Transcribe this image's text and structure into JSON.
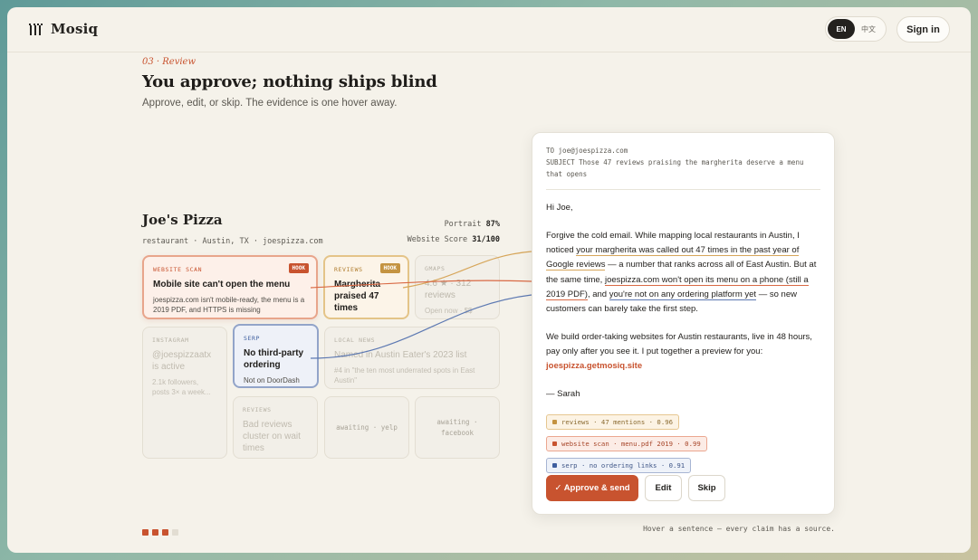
{
  "brand": {
    "name": "Mosiq"
  },
  "header": {
    "lang_en": "EN",
    "lang_zh": "中文",
    "signin_label": "Sign in"
  },
  "hero": {
    "eyebrow": "03 · Review",
    "title": "You approve; nothing ships blind",
    "subtitle": "Approve, edit, or skip. The evidence is one hover away."
  },
  "business": {
    "name": "Joe's Pizza",
    "meta": "restaurant · Austin, TX · joespizza.com",
    "portrait_label": "Portrait",
    "portrait_value": "87%",
    "score_label": "Website Score",
    "score_value": "31/100"
  },
  "cards": {
    "website_scan": {
      "tag": "WEBSITE SCAN",
      "hook": "HOOK",
      "title": "Mobile site can't open the menu",
      "body": "joespizza.com isn't mobile-ready, the menu is a 2019 PDF, and HTTPS is missing"
    },
    "reviews": {
      "tag": "REVIEWS",
      "hook": "HOOK",
      "title": "Margherita praised 47 times"
    },
    "gmaps": {
      "tag": "GMAPS",
      "title": "4.6 ★ · 312 reviews",
      "body": "Open now · $$"
    },
    "instagram": {
      "tag": "INSTAGRAM",
      "title": "@joespizzaatx is active",
      "body": "2.1k followers, posts 3× a week..."
    },
    "serp": {
      "tag": "SERP",
      "title": "No third-party ordering",
      "body": "Not on DoorDash"
    },
    "local_news": {
      "tag": "LOCAL NEWS",
      "title": "Named in Austin Eater's 2023 list",
      "body": "#4 in \"the ten most underrated spots in East Austin\""
    },
    "reviews2": {
      "tag": "REVIEWS",
      "title": "Bad reviews cluster on wait times"
    },
    "await_yelp": {
      "text": "awaiting · yelp"
    },
    "await_facebook": {
      "text": "awaiting · facebook"
    }
  },
  "email": {
    "to": "TO joe@joespizza.com",
    "subject": "SUBJECT Those 47 reviews praising the margherita deserve a menu that opens",
    "greeting": "Hi Joe,",
    "p1_a": "Forgive the cold email. While mapping local restaurants in Austin, I noticed ",
    "p1_hl1": "your margherita was called out 47 times in the past year of Google reviews",
    "p1_b": " — a number that ranks across all of East Austin. But at the same time, ",
    "p1_hl2": "joespizza.com won't open its menu on a phone (still a 2019 PDF)",
    "p1_c": ", and ",
    "p1_hl3": "you're not on any ordering platform yet",
    "p1_d": " — so new customers can barely take the first step.",
    "p2": "We build order-taking websites for Austin restaurants, live in 48 hours, pay only after you see it. I put together a preview for you:",
    "link": "joespizza.getmosiq.site",
    "signoff": "— Sarah"
  },
  "evidence": [
    {
      "text": "reviews · 47 mentions · 0.96",
      "color": "#c49341"
    },
    {
      "text": "website scan · menu.pdf 2019 · 0.99",
      "color": "#c8532f"
    },
    {
      "text": "serp · no ordering links · 0.91",
      "color": "#3f5f9f"
    }
  ],
  "actions": {
    "approve": "✓ Approve & send",
    "edit": "Edit",
    "skip": "Skip"
  },
  "hint": "Hover a sentence — every claim has a source.",
  "pager": {
    "total": 4,
    "current": 3
  }
}
